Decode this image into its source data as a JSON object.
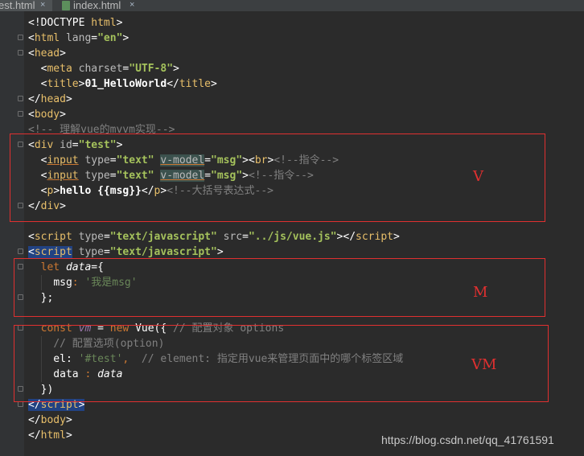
{
  "tabs": [
    {
      "label": "est.html",
      "close": "×"
    },
    {
      "label": "index.html",
      "close": "×"
    }
  ],
  "code": [
    [
      "<!DOCTYPE",
      " html",
      ">"
    ],
    [
      "<",
      "html",
      " lang",
      "=",
      "\"en\"",
      ">"
    ],
    [
      "<",
      "head",
      ">"
    ],
    [
      "  <",
      "meta",
      " charset",
      "=",
      "\"UTF-8\"",
      ">"
    ],
    [
      "  <",
      "title",
      ">",
      "01_HelloWorld",
      "</",
      "title",
      ">"
    ],
    [
      "</",
      "head",
      ">"
    ],
    [
      "<",
      "body",
      ">"
    ],
    [
      "<!-- 理解vue的mvvm实现-->"
    ],
    [
      "<",
      "div",
      " id",
      "=",
      "\"test\"",
      ">"
    ],
    [
      "  <",
      "input",
      " type",
      "=",
      "\"text\"",
      " ",
      "v-model",
      "=",
      "\"msg\"",
      ">",
      "<",
      "br",
      ">",
      "<!--指令-->"
    ],
    [
      "  <",
      "input",
      " type",
      "=",
      "\"text\"",
      " ",
      "v-model",
      "=",
      "\"msg\"",
      ">",
      "<!--指令-->"
    ],
    [
      "  <",
      "p",
      ">",
      "hello {{msg}}",
      "</",
      "p",
      ">",
      "<!--大括号表达式-->"
    ],
    [
      "</",
      "div",
      ">"
    ],
    [
      ""
    ],
    [
      "<",
      "script",
      " type",
      "=",
      "\"text/javascript\"",
      " src",
      "=",
      "\"../js/vue.js\"",
      ">",
      "</",
      "script",
      ">"
    ],
    [
      "<",
      "script",
      " type",
      "=",
      "\"text/javascript\"",
      ">"
    ],
    [
      "  ",
      "let",
      " ",
      "data",
      "=",
      "{"
    ],
    [
      "    ",
      "msg",
      ": ",
      "'我是msg'"
    ],
    [
      "  };"
    ],
    [
      ""
    ],
    [
      "  ",
      "const",
      " ",
      "vm",
      " = ",
      "new",
      " Vue({ ",
      "// 配置对象 options"
    ],
    [
      "    ",
      "// 配置选项(option)"
    ],
    [
      "    el: ",
      "'#test'",
      ",  ",
      "// element: 指定用vue来管理页面中的哪个标签区域"
    ],
    [
      "    data ",
      ":",
      " ",
      "data"
    ],
    [
      "  })"
    ],
    [
      "</",
      "script",
      ">"
    ],
    [
      "</",
      "body",
      ">"
    ],
    [
      "</",
      "html",
      ">"
    ]
  ],
  "annotations": {
    "v": "V",
    "m": "M",
    "vm": "VM"
  },
  "watermark": "https://blog.csdn.net/qq_41761591",
  "colors": {
    "background": "#2b2b2b",
    "tag": "#e8bf6a",
    "string": "#a5c25c",
    "comment": "#808080",
    "keyword": "#cc7832",
    "annotation": "#e03030"
  }
}
